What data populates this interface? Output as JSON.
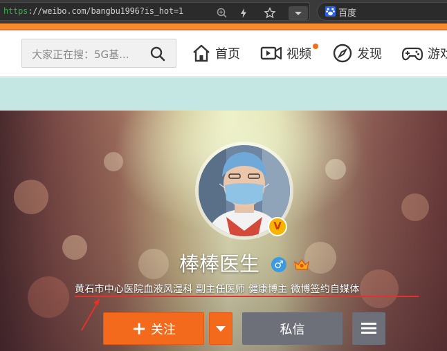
{
  "browser": {
    "url_scheme": "https",
    "url_rest": "://weibo.com/bangbu1996?is_hot=1",
    "search_engine": "百度",
    "icons": [
      "zoom-icon",
      "lightning-icon",
      "star-icon",
      "chevron-down-icon",
      "baidu-icon"
    ]
  },
  "nav": {
    "search_placeholder": "大家正在搜：5G基...",
    "items": [
      {
        "label": "首页",
        "icon": "home-icon"
      },
      {
        "label": "视频",
        "icon": "video-icon"
      },
      {
        "label": "发现",
        "icon": "compass-icon"
      },
      {
        "label": "游戏",
        "icon": "gamepad-icon"
      }
    ]
  },
  "profile": {
    "name": "棒棒医生",
    "gender_symbol": "♂",
    "verified_mark": "V",
    "bio": "黄石市中心医院血液风湿科 副主任医师 健康博主 微博签约自媒体"
  },
  "actions": {
    "follow_plus": "+",
    "follow_label": "关注",
    "message_label": "私信"
  },
  "colors": {
    "accent_orange": "#f36a1c",
    "nav_stripe": "#f88a2e",
    "secondary_button": "#6e7079",
    "annotation_red": "#e4322b"
  }
}
